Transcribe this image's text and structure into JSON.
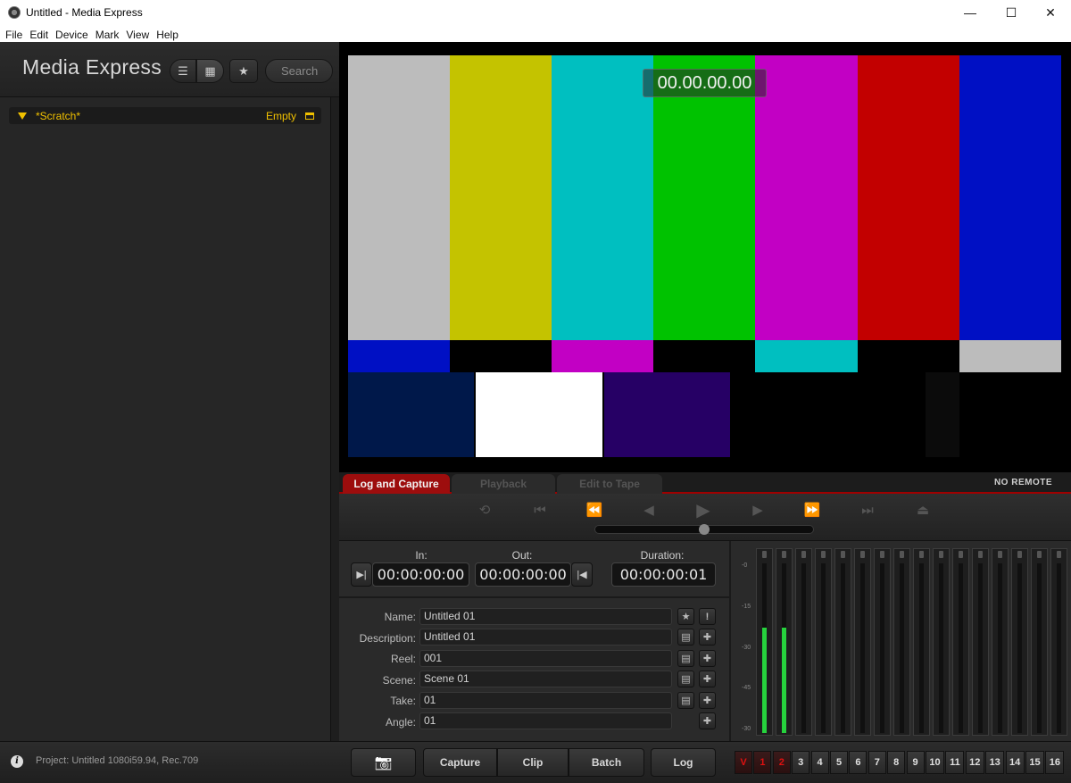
{
  "window": {
    "title": "Untitled - Media Express",
    "minimize_glyph": "—",
    "maximize_glyph": "☐",
    "close_glyph": "✕"
  },
  "menu": [
    "File",
    "Edit",
    "Device",
    "Mark",
    "View",
    "Help"
  ],
  "sidebar": {
    "app_name": "Media Express",
    "list_view_glyph": "☰",
    "grid_view_glyph": "▦",
    "favorites_glyph": "★",
    "search_placeholder": "Search",
    "bin": {
      "name": "*Scratch*",
      "status": "Empty"
    }
  },
  "viewer": {
    "timecode": "00.00.00.00",
    "colors": {
      "gray": "#bcbcbc",
      "yellow": "#c4c300",
      "cyan": "#00bfc0",
      "green": "#00c200",
      "magenta": "#c200c4",
      "red": "#c20000",
      "blue": "#0010c4",
      "navy": "#00184a",
      "white": "#ffffff",
      "purple": "#260065"
    }
  },
  "tabs": {
    "items": [
      "Log and Capture",
      "Playback",
      "Edit to Tape"
    ],
    "active": "Log and Capture",
    "remote_status": "NO REMOTE"
  },
  "transport": {
    "icons": [
      "loop-icon",
      "go-to-in-icon",
      "rewind-icon",
      "step-back-icon",
      "play-icon",
      "step-forward-icon",
      "fast-forward-icon",
      "go-to-out-icon",
      "eject-icon"
    ],
    "glyphs": {
      "loop": "⟲",
      "go_to_in": "⏮",
      "rewind": "⏪",
      "step_back": "◀",
      "play": "▶",
      "step_forward": "▶",
      "fast_forward": "⏩",
      "go_to_out": "⏭",
      "eject": "⏏"
    }
  },
  "log": {
    "in_label": "In:",
    "out_label": "Out:",
    "duration_label": "Duration:",
    "in_tc": "00:00:00:00",
    "out_tc": "00:00:00:00",
    "duration_tc": "00:00:00:01",
    "set_in_glyph": "▶|",
    "set_out_glyph": "|◀",
    "fields": [
      {
        "label": "Name:",
        "value": "Untitled 01"
      },
      {
        "label": "Description:",
        "value": "Untitled 01"
      },
      {
        "label": "Reel:",
        "value": "001"
      },
      {
        "label": "Scene:",
        "value": "Scene 01"
      },
      {
        "label": "Take:",
        "value": "01"
      },
      {
        "label": "Angle:",
        "value": "01"
      }
    ],
    "star_glyph": "★",
    "exclaim_glyph": "!",
    "list_glyph": "▤",
    "plus_glyph": "✚"
  },
  "meters": {
    "db_marks": [
      "-0",
      "-15",
      "-30",
      "-45",
      "-30"
    ],
    "channel_levels": [
      0.62,
      0.62,
      0,
      0,
      0,
      0,
      0,
      0,
      0,
      0,
      0,
      0,
      0,
      0,
      0,
      0
    ]
  },
  "bottom": {
    "info_glyph": "i",
    "project_info": "Project: Untitled  1080i59.94, Rec.709",
    "camera_glyph": "📷",
    "capture_label": "Capture",
    "clip_label": "Clip",
    "batch_label": "Batch",
    "log_label": "Log",
    "channels": [
      "V",
      "1",
      "2",
      "3",
      "4",
      "5",
      "6",
      "7",
      "8",
      "9",
      "10",
      "11",
      "12",
      "13",
      "14",
      "15",
      "16"
    ],
    "enabled_channels": [
      "V",
      "1",
      "2"
    ]
  }
}
